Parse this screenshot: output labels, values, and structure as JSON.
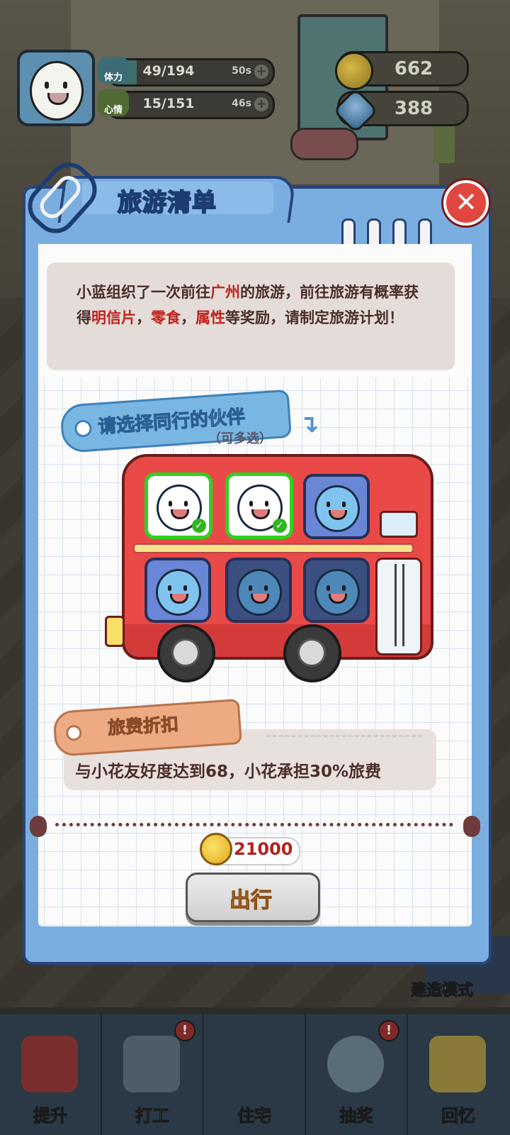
{
  "hud": {
    "stamina_label": "体力",
    "stamina_value": "49/194",
    "stamina_timer": "50s",
    "mood_label": "心情",
    "mood_value": "15/151",
    "mood_timer": "46s",
    "coins": "662",
    "gems": "388"
  },
  "dialog": {
    "title": "旅游清单",
    "close_symbol": "✕",
    "info": {
      "p1": "小蓝组织了一次前往",
      "city": "广州",
      "p2": "的旅游，前往旅游有概率获得",
      "r1": "明信片",
      "sep1": "，",
      "r2": "零食",
      "sep2": "，",
      "r3": "属性",
      "p3": "等奖励，请制定旅游计划！"
    },
    "select_label": "请选择同行的伙伴",
    "select_sub": "（可多选）",
    "arrow": "↴",
    "companions": [
      {
        "selected": true
      },
      {
        "selected": true
      },
      {
        "selected": false
      },
      {
        "selected": false
      },
      {
        "selected": false
      },
      {
        "selected": false
      }
    ],
    "check_symbol": "✓",
    "discount_title": "旅费折扣",
    "discount_text": "与小花友好度达到68，小花承担30%旅费",
    "cost": "21000",
    "go_label": "出行"
  },
  "build_mode": "建造模式",
  "bottom_nav": [
    {
      "label": "提升",
      "badge": ""
    },
    {
      "label": "打工",
      "badge": "!"
    },
    {
      "label": "住宅",
      "badge": ""
    },
    {
      "label": "抽奖",
      "badge": "!"
    },
    {
      "label": "回忆",
      "badge": ""
    }
  ],
  "colors": {
    "dialog_blue": "#7aaee0",
    "highlight_red": "#c0211c",
    "select_green": "#2fd21f",
    "bus_red": "#e94a48",
    "go_text_orange": "#e4a31c"
  }
}
